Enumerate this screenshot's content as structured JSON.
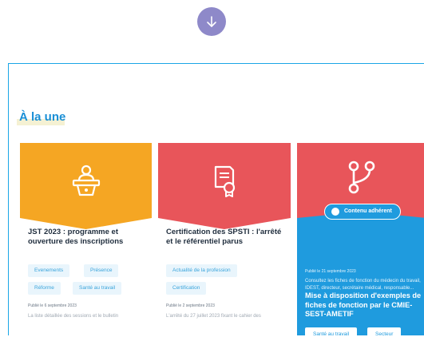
{
  "icons": {
    "scroll": "arrow-down-icon",
    "card1": "conference-speaker-icon",
    "card2": "certificate-icon",
    "card3": "branch-fork-icon",
    "badge": "user-circle-icon"
  },
  "colors": {
    "accent": "#1a8fd6",
    "card_orange": "#f5a623",
    "card_red": "#e8555a",
    "card_red_icon": "#e27176",
    "card_blue": "#1f9bde",
    "tag_bg": "#e9f5fc",
    "tag_text": "#3aa4db",
    "scroll_button": "#8e89c9"
  },
  "section": {
    "title": "À la une"
  },
  "cards": [
    {
      "title": "JST 2023 : programme et ouverture des inscriptions",
      "tags": [
        "Evenements",
        "Présence",
        "Réforme",
        "Santé au travail"
      ],
      "date": "Publié le 6 septembre 2023",
      "excerpt": "La liste détaillée des sessions et le bulletin"
    },
    {
      "title": "Certification des SPSTI : l'arrêté et le référentiel parus",
      "tags": [
        "Actualité de la profession",
        "Certification"
      ],
      "date": "Publié le 2 septembre 2023",
      "excerpt": "L'arrêté du 27 juillet 2023 fixant le cahier des"
    },
    {
      "badge": "Contenu adhérent",
      "title": "Mise à disposition d'exemples de fiches de fonction par le CMIE-SEST-AMETIF",
      "buttons": [
        "Santé au travail",
        "Secteur"
      ],
      "date": "Publié le 21 septembre 2023",
      "excerpt": "Consultez les fiches de fonction du médecin du travail, IDEST, directeur, secrétaire médical, responsable..."
    }
  ]
}
